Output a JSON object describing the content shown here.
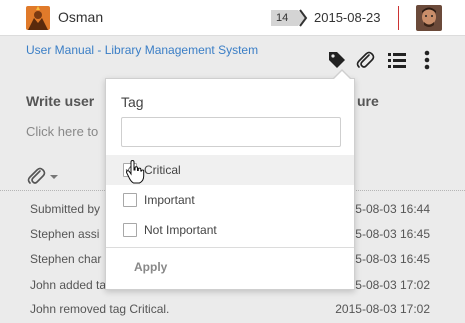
{
  "header": {
    "username": "Osman",
    "count": "14",
    "date": "2015-08-23",
    "divider_color": "#cc3333"
  },
  "toolbar": {
    "breadcrumb": "User Manual - Library Management System",
    "icons": [
      "tag-icon",
      "paperclip-icon",
      "list-icon",
      "more-vertical-icon"
    ]
  },
  "main": {
    "title_left": "Write user",
    "title_right": "ure",
    "click_here": "Click here to",
    "history": [
      {
        "text": "Submitted by",
        "time": "2015-08-03 16:44"
      },
      {
        "text": "Stephen assi",
        "time": "2015-08-03 16:45"
      },
      {
        "text": "Stephen char",
        "time": "2015-08-03 16:45"
      },
      {
        "text": "John added ta",
        "time": "2015-08-03 17:02"
      },
      {
        "text": "John removed tag Critical.",
        "time": "2015-08-03 17:02"
      }
    ]
  },
  "tag_popup": {
    "title": "Tag",
    "search_value": "",
    "options": [
      {
        "label": "Critical",
        "checked": true
      },
      {
        "label": "Important",
        "checked": false
      },
      {
        "label": "Not Important",
        "checked": false
      }
    ],
    "apply_label": "Apply"
  }
}
